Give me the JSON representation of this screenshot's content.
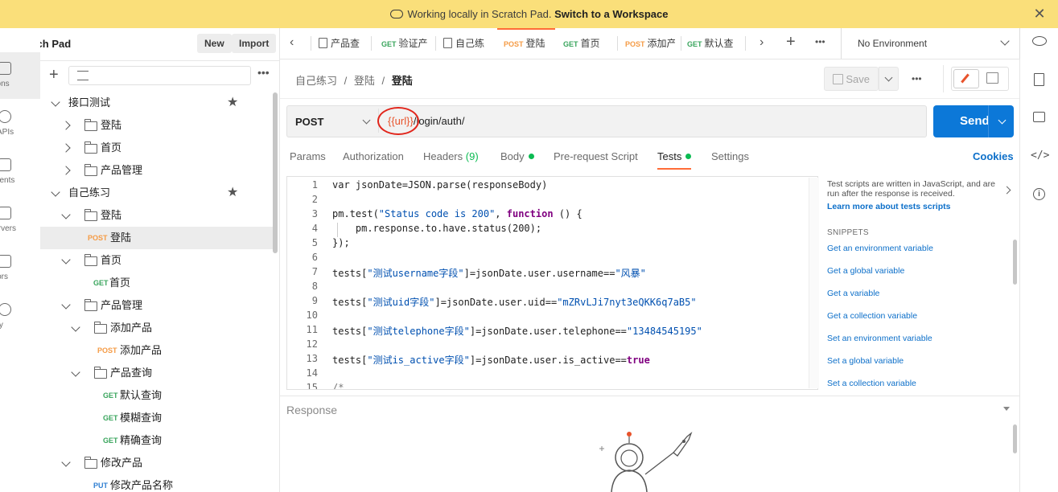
{
  "banner": {
    "text": "Working locally in Scratch Pad.",
    "link": "Switch to a Workspace"
  },
  "rail": {
    "items": [
      {
        "label": "ections",
        "icon": "collections-icon"
      },
      {
        "label": "APIs",
        "icon": "apis-icon"
      },
      {
        "label": "onments",
        "icon": "environments-icon"
      },
      {
        "label": "t Servers",
        "icon": "mock-servers-icon"
      },
      {
        "label": "onitors",
        "icon": "monitors-icon"
      },
      {
        "label": "istory",
        "icon": "history-icon"
      }
    ]
  },
  "sidebar": {
    "title": "atch Pad",
    "new_label": "New",
    "import_label": "Import",
    "tree": [
      {
        "label": "接口测试",
        "type": "collection"
      },
      {
        "label": "登陆",
        "type": "folder"
      },
      {
        "label": "首页",
        "type": "folder"
      },
      {
        "label": "产品管理",
        "type": "folder"
      },
      {
        "label": "自己练习",
        "type": "collection"
      },
      {
        "label": "登陆",
        "type": "folder"
      },
      {
        "label": "登陆",
        "type": "request",
        "method": "POST"
      },
      {
        "label": "首页",
        "type": "folder"
      },
      {
        "label": "首页",
        "type": "request",
        "method": "GET"
      },
      {
        "label": "产品管理",
        "type": "folder"
      },
      {
        "label": "添加产品",
        "type": "folder"
      },
      {
        "label": "添加产品",
        "type": "request",
        "method": "POST"
      },
      {
        "label": "产品查询",
        "type": "folder"
      },
      {
        "label": "默认查询",
        "type": "request",
        "method": "GET"
      },
      {
        "label": "模糊查询",
        "type": "request",
        "method": "GET"
      },
      {
        "label": "精确查询",
        "type": "request",
        "method": "GET"
      },
      {
        "label": "修改产品",
        "type": "folder"
      },
      {
        "label": "修改产品名称",
        "type": "request",
        "method": "PUT"
      }
    ]
  },
  "tabs": [
    {
      "method": "",
      "label": "产品查"
    },
    {
      "method": "GET",
      "label": "验证产"
    },
    {
      "method": "",
      "label": "自己练"
    },
    {
      "method": "POST",
      "label": "登陆"
    },
    {
      "method": "GET",
      "label": "首页"
    },
    {
      "method": "POST",
      "label": "添加产"
    },
    {
      "method": "GET",
      "label": "默认查"
    }
  ],
  "environment": "No Environment",
  "breadcrumb": {
    "a": "自己练习",
    "b": "登陆",
    "c": "登陆",
    "sep": "/"
  },
  "save_label": "Save",
  "request": {
    "method": "POST",
    "url_var": "{{url}}",
    "url_rest": "/login/auth/"
  },
  "send_label": "Send",
  "subtabs": {
    "params": "Params",
    "authorization": "Authorization",
    "headers": "Headers",
    "headers_count": "(9)",
    "body": "Body",
    "prerequest": "Pre-request Script",
    "tests": "Tests",
    "settings": "Settings",
    "cookies": "Cookies"
  },
  "code_lines": [
    "1",
    "2",
    "3",
    "4",
    "5",
    "6",
    "7",
    "8",
    "9",
    "10",
    "11",
    "12",
    "13",
    "14",
    "15"
  ],
  "code": {
    "l1": "var jsonDate=JSON.parse(responseBody)",
    "l3a": "pm.test(",
    "l3b": "\"Status code is 200\"",
    "l3c": ", ",
    "l3d": "function",
    "l3e": " () {",
    "l4": "    pm.response.to.have.status(200);",
    "l5": "});",
    "l7a": "tests[",
    "l7b": "\"测试username字段\"",
    "l7c": "]=jsonDate.user.username==",
    "l7d": "\"风暴\"",
    "l9a": "tests[",
    "l9b": "\"测试uid字段\"",
    "l9c": "]=jsonDate.user.uid==",
    "l9d": "\"mZRvLJi7nyt3eQKK6q7aB5\"",
    "l11a": "tests[",
    "l11b": "\"测试telephone字段\"",
    "l11c": "]=jsonDate.user.telephone==",
    "l11d": "\"13484545195\"",
    "l13a": "tests[",
    "l13b": "\"测试is_active字段\"",
    "l13c": "]=jsonDate.user.is_active==",
    "l13d": "true",
    "l15": "/*"
  },
  "snippets": {
    "desc": "Test scripts are written in JavaScript, and are run after the response is received.",
    "learn": "Learn more about tests scripts",
    "heading": "SNIPPETS",
    "items": [
      "Get an environment variable",
      "Get a global variable",
      "Get a variable",
      "Get a collection variable",
      "Set an environment variable",
      "Set a global variable",
      "Set a collection variable"
    ]
  },
  "response": {
    "title": "Response"
  }
}
